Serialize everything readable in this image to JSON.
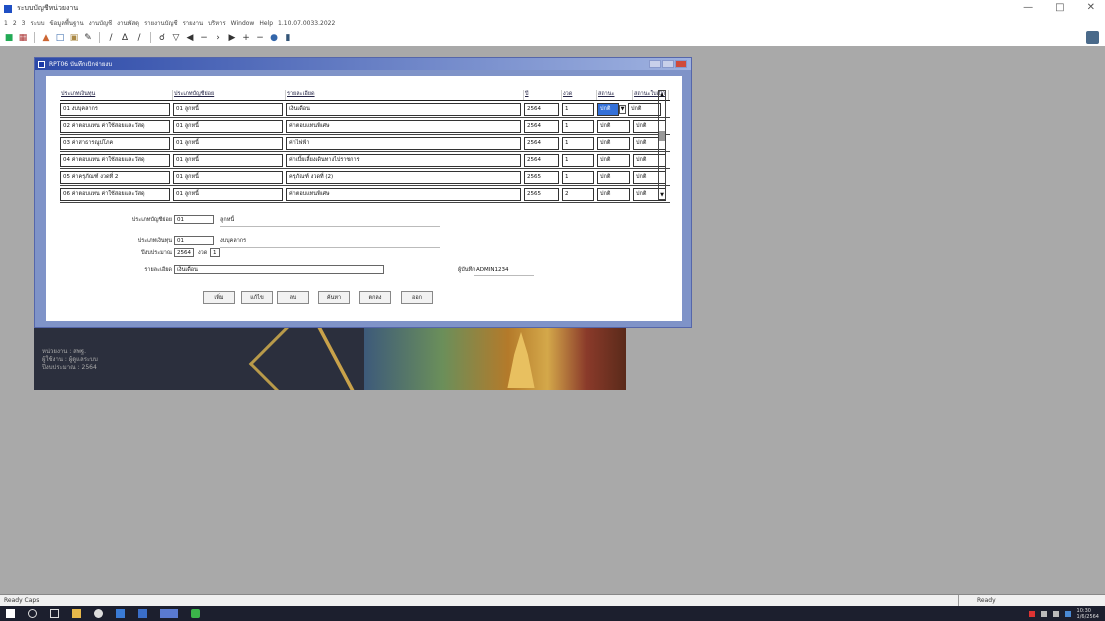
{
  "app": {
    "title": "ระบบบัญชีหน่วยงาน",
    "window_controls": [
      "—",
      "□",
      "✕"
    ]
  },
  "menubar": [
    "1",
    "2",
    "3",
    "ระบบ",
    "ข้อมูลพื้นฐาน",
    "งานบัญชี",
    "งานพัสดุ",
    "รายงานบัญชี",
    "รายงาน",
    "บริหาร",
    "Window",
    "Help",
    "1.10.07.0033.2022"
  ],
  "toolbar": {
    "icons": [
      "save-icon",
      "print-icon",
      "preview-icon",
      "copy-icon",
      "paste-icon",
      "edit-icon",
      "italic-icon",
      "underline-icon",
      "find-icon",
      "filter-icon",
      "first-icon",
      "prev-icon",
      "next-icon",
      "last-icon",
      "add-icon",
      "delete-icon",
      "help-icon",
      "exit-icon"
    ]
  },
  "dialog": {
    "title": "RPT06 บันทึกเบิกจ่ายงบ",
    "grid": {
      "headers": [
        "ประเภทเงินทุน",
        "ประเภทบัญชีย่อย",
        "รายละเอียด",
        "ปี",
        "งวด",
        "สถานะ",
        "สถานะใบเบิก"
      ],
      "rows": [
        {
          "c1": "01   งบบุคลากร",
          "c2": "01   ลูกหนี้",
          "c3": "เงินเดือน",
          "c4": "2564",
          "c5": "1",
          "c6": "ปกติ",
          "c7": "ปกติ",
          "selected": true
        },
        {
          "c1": "02   ค่าตอบแทน ค่าใช้สอยและวัสดุ",
          "c2": "01   ลูกหนี้",
          "c3": "ค่าตอบแทนพิเศษ",
          "c4": "2564",
          "c5": "1",
          "c6": "ปกติ",
          "c7": "ปกติ",
          "selected": false
        },
        {
          "c1": "03   ค่าสาธารณูปโภค",
          "c2": "01   ลูกหนี้",
          "c3": "ค่าไฟฟ้า",
          "c4": "2564",
          "c5": "1",
          "c6": "ปกติ",
          "c7": "ปกติ",
          "selected": false
        },
        {
          "c1": "04   ค่าตอบแทน ค่าใช้สอยและวัสดุ",
          "c2": "01   ลูกหนี้",
          "c3": "ค่าเบี้ยเลี้ยงเดินทางไปราชการ",
          "c4": "2564",
          "c5": "1",
          "c6": "ปกติ",
          "c7": "ปกติ",
          "selected": false
        },
        {
          "c1": "05   ค่าครุภัณฑ์ งวดที่ 2",
          "c2": "01   ลูกหนี้",
          "c3": "ครุภัณฑ์ งวดที่ (2)",
          "c4": "2565",
          "c5": "1",
          "c6": "ปกติ",
          "c7": "ปกติ",
          "selected": false
        },
        {
          "c1": "06   ค่าตอบแทน ค่าใช้สอยและวัสดุ",
          "c2": "01   ลูกหนี้",
          "c3": "ค่าตอบแทนพิเศษ",
          "c4": "2565",
          "c5": "2",
          "c6": "ปกติ",
          "c7": "ปกติ",
          "selected": false
        }
      ]
    },
    "form": {
      "f1_label": "ประเภทบัญชีย่อย",
      "f1_value": "01",
      "f1_unit": "ลูกหนี้",
      "f2_label": "ประเภทเงินทุน",
      "f2_value": "01",
      "f2_unit": "งบบุคลากร",
      "f3_label": "ปีงบประมาณ",
      "f3_value": "2564",
      "f3_mid": "งวด",
      "f3_value2": "1",
      "f4_label": "รายละเอียด",
      "f4_value": "เงินเดือน",
      "f4_right_label": "ผู้บันทึก",
      "f4_right_value": "ADMIN1234"
    },
    "buttons": [
      "เพิ่ม",
      "แก้ไข",
      "ลบ",
      "ค้นหา",
      "ตกลง",
      "ออก"
    ]
  },
  "banner": {
    "lines": [
      "หน่วยงาน : สพฐ.",
      "ผู้ใช้งาน : ผู้ดูแลระบบ",
      "ปีงบประมาณ : 2564"
    ]
  },
  "statusbar": {
    "left": "Ready  Caps",
    "right": "Ready"
  },
  "taskbar": {
    "time": "10:30",
    "date": "1/6/2564"
  }
}
